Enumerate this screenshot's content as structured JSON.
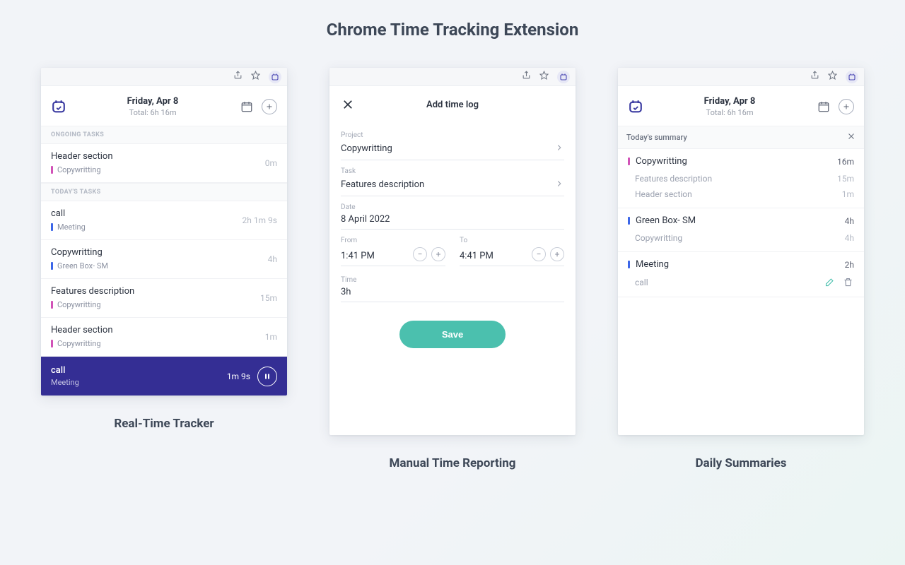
{
  "page_title": "Chrome Time Tracking Extension",
  "captions": {
    "tracker": "Real-Time Tracker",
    "manual": "Manual Time Reporting",
    "summary": "Daily Summaries"
  },
  "colors": {
    "pink": "#d152b7",
    "blue": "#3c66e8",
    "active_bg": "#342e94",
    "accent": "#4bc0ae"
  },
  "header": {
    "date": "Friday, Apr 8",
    "total": "Total: 6h 16m"
  },
  "tracker": {
    "section_ongoing": "ONGOING TASKS",
    "section_today": "TODAY'S TASKS",
    "ongoing": [
      {
        "title": "Header section",
        "project": "Copywritting",
        "color": "pink",
        "time": "0m"
      }
    ],
    "today": [
      {
        "title": "call",
        "project": "Meeting",
        "color": "blue",
        "time": "2h 1m 9s"
      },
      {
        "title": "Copywritting",
        "project": "Green Box- SM",
        "color": "blue",
        "time": "4h"
      },
      {
        "title": "Features description",
        "project": "Copywritting",
        "color": "pink",
        "time": "15m"
      },
      {
        "title": "Header section",
        "project": "Copywritting",
        "color": "pink",
        "time": "1m"
      }
    ],
    "active": {
      "title": "call",
      "project": "Meeting",
      "time": "1m 9s"
    }
  },
  "manual": {
    "title": "Add time log",
    "labels": {
      "project": "Project",
      "task": "Task",
      "date": "Date",
      "from": "From",
      "to": "To",
      "time": "Time"
    },
    "project": "Copywritting",
    "task": "Features description",
    "date": "8 April 2022",
    "from": "1:41 PM",
    "to": "4:41 PM",
    "time": "3h",
    "save": "Save"
  },
  "summary": {
    "bar_label": "Today's summary",
    "groups": [
      {
        "name": "Copywritting",
        "color": "pink",
        "total": "16m",
        "items": [
          {
            "name": "Features description",
            "time": "15m"
          },
          {
            "name": "Header section",
            "time": "1m"
          }
        ]
      },
      {
        "name": "Green Box- SM",
        "color": "blue",
        "total": "4h",
        "items": [
          {
            "name": "Copywritting",
            "time": "4h"
          }
        ]
      },
      {
        "name": "Meeting",
        "color": "blue",
        "total": "2h",
        "items": [
          {
            "name": "call",
            "time": "",
            "editable": true
          }
        ]
      }
    ]
  }
}
